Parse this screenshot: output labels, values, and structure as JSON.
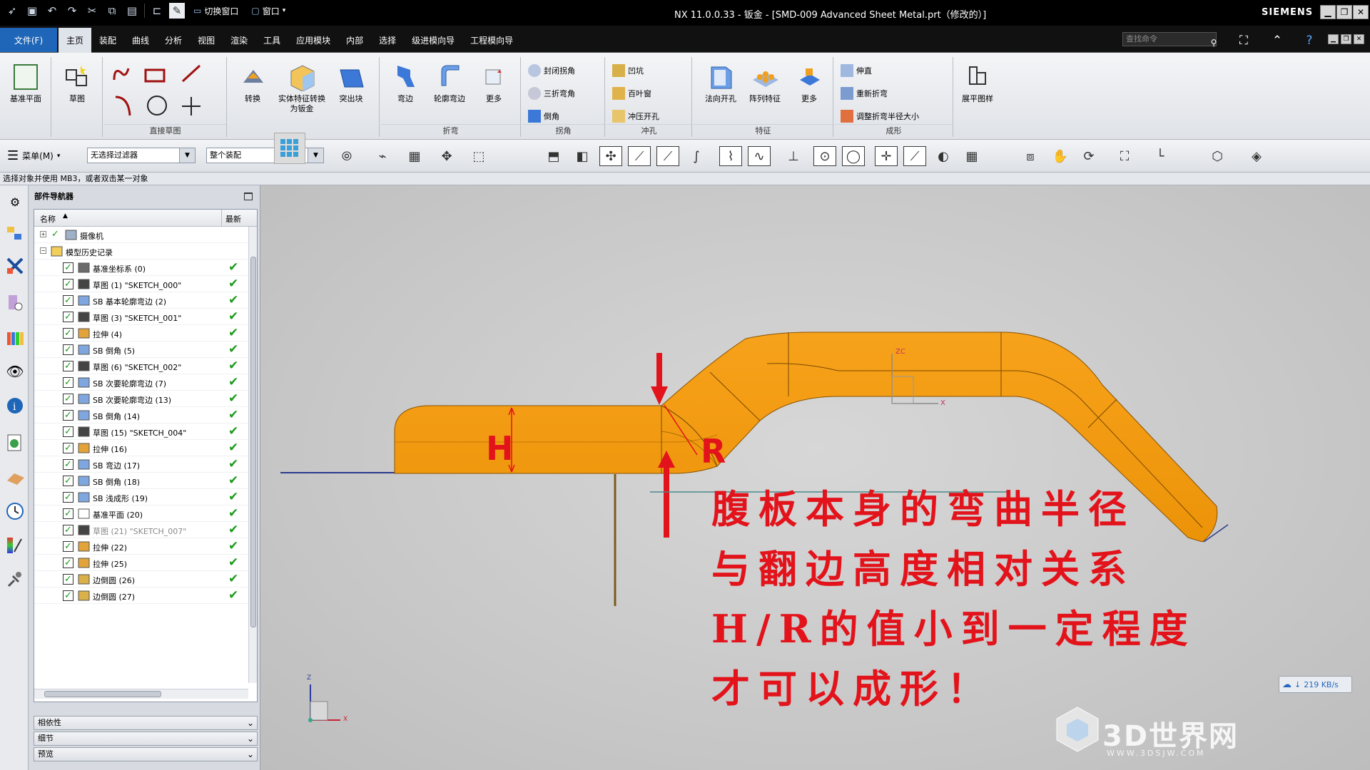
{
  "window": {
    "title": "NX 11.0.0.33 - 钣金 - [SMD-009 Advanced Sheet Metal.prt（修改的）]",
    "brand": "SIEMENS",
    "switch_window": "切换窗口",
    "window_menu": "窗口"
  },
  "menu": {
    "file": "文件(F)",
    "tabs": [
      "主页",
      "装配",
      "曲线",
      "分析",
      "视图",
      "渲染",
      "工具",
      "应用模块",
      "内部",
      "选择",
      "级进模向导",
      "工程模向导"
    ],
    "active_tab": 0,
    "search_placeholder": "查找命令"
  },
  "ribbon": {
    "datum_plane": "基准平面",
    "sketch": "草图",
    "direct_sketch": "直接草图",
    "convert": "转换",
    "solid_to_sheet": "实体特征转换为钣金",
    "tab": "突出块",
    "flange": "弯边",
    "contour_flange": "轮廓弯边",
    "more": "更多",
    "fold_group": "折弯",
    "closed_corner": "封闭拐角",
    "three_bend_corner": "三折弯角",
    "chamfer": "倒角",
    "corner_group": "拐角",
    "dimple": "凹坑",
    "louver": "百叶窗",
    "drawn_cutout": "冲压开孔",
    "punch_group": "冲孔",
    "normal_cutout": "法向开孔",
    "pattern_feature": "阵列特征",
    "feature_group": "特征",
    "unbend": "伸直",
    "rebend": "重新折弯",
    "resize_bend_radius": "调整折弯半径大小",
    "form_group": "成形",
    "flat_pattern": "展平图样"
  },
  "toolbar2": {
    "menu": "菜单(M)",
    "filter": "无选择过滤器",
    "scope": "整个装配"
  },
  "status": "选择对象并使用 MB3，或者双击某一对象",
  "navigator": {
    "title": "部件导航器",
    "col_name": "名称",
    "col_new": "最新",
    "rows": [
      {
        "label": "摄像机",
        "level": 0,
        "expand": "+",
        "dim": false
      },
      {
        "label": "模型历史记录",
        "level": 0,
        "expand": "−",
        "dim": false
      },
      {
        "label": "基准坐标系 (0)",
        "level": 1,
        "dim": false
      },
      {
        "label": "草图 (1) \"SKETCH_000\"",
        "level": 1,
        "dim": false
      },
      {
        "label": "SB 基本轮廓弯边 (2)",
        "level": 1,
        "dim": false
      },
      {
        "label": "草图 (3) \"SKETCH_001\"",
        "level": 1,
        "dim": false
      },
      {
        "label": "拉伸 (4)",
        "level": 1,
        "dim": false
      },
      {
        "label": "SB 倒角 (5)",
        "level": 1,
        "dim": false
      },
      {
        "label": "草图 (6) \"SKETCH_002\"",
        "level": 1,
        "dim": false
      },
      {
        "label": "SB 次要轮廓弯边 (7)",
        "level": 1,
        "dim": false
      },
      {
        "label": "SB 次要轮廓弯边 (13)",
        "level": 1,
        "dim": false
      },
      {
        "label": "SB 倒角 (14)",
        "level": 1,
        "dim": false
      },
      {
        "label": "草图 (15) \"SKETCH_004\"",
        "level": 1,
        "dim": false
      },
      {
        "label": "拉伸 (16)",
        "level": 1,
        "dim": false
      },
      {
        "label": "SB 弯边 (17)",
        "level": 1,
        "dim": false
      },
      {
        "label": "SB 倒角 (18)",
        "level": 1,
        "dim": false
      },
      {
        "label": "SB 浅成形 (19)",
        "level": 1,
        "dim": false
      },
      {
        "label": "基准平面 (20)",
        "level": 1,
        "dim": false
      },
      {
        "label": "草图 (21) \"SKETCH_007\"",
        "level": 1,
        "dim": true
      },
      {
        "label": "拉伸 (22)",
        "level": 1,
        "dim": false
      },
      {
        "label": "拉伸 (25)",
        "level": 1,
        "dim": false
      },
      {
        "label": "边倒圆 (26)",
        "level": 1,
        "dim": false
      },
      {
        "label": "边倒圆 (27)",
        "level": 1,
        "dim": false
      }
    ],
    "panels": [
      "相依性",
      "细节",
      "预览"
    ]
  },
  "viewport": {
    "annotation_lines": [
      "腹板本身的弯曲半径",
      "与翻边高度相对关系",
      "H/R的值小到一定程度",
      "才可以成形！"
    ],
    "dim_h": "H",
    "dim_r": "R",
    "axis_zc": "ZC",
    "axis_x": "X",
    "axis_z": "Z",
    "speed": "219 KB/s",
    "watermark": "3D世界网",
    "watermark_sub": "WWW.3DSJW.COM",
    "part_color": "#f59e0b",
    "annotation_color": "#e3131b"
  }
}
